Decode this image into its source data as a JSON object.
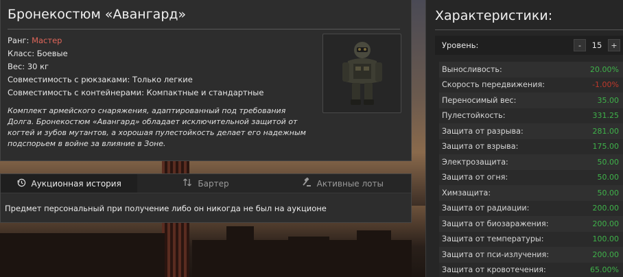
{
  "item": {
    "title": "Бронекостюм «Авангард»",
    "rank_label": "Ранг:",
    "rank_value": "Мастер",
    "class_line": "Класс: Боевые",
    "weight_line": "Вес: 30 кг",
    "backpack_line": "Совместимость с рюкзаками: Только легкие",
    "container_line": "Совместимость с контейнерами: Компактные и стандартные",
    "description": "Комплект армейского снаряжения, адаптированный под требования Долга. Бронекостюм «Авангард» обладает исключительной защитой от когтей и зубов мутантов, а хорошая пулестойкость делает его надежным подспорьем в войне за влияние в Зоне."
  },
  "tabs": [
    {
      "label": "Аукционная история",
      "icon": "history-icon",
      "active": true
    },
    {
      "label": "Бартер",
      "icon": "swap-icon",
      "active": false
    },
    {
      "label": "Активные лоты",
      "icon": "gavel-icon",
      "active": false
    }
  ],
  "tab_message": "Предмет персональный при получение либо он никогда не был на аукционе",
  "stats": {
    "title": "Характеристики:",
    "level_label": "Уровень:",
    "level_value": "15",
    "minus_label": "-",
    "plus_label": "+",
    "rows": [
      {
        "name": "Выносливость:",
        "value": "20.00%",
        "color": "#3fb24a"
      },
      {
        "name": "Скорость передвижения:",
        "value": "-1.00%",
        "color": "#c0392b"
      },
      {
        "name": "Переносимый вес:",
        "value": "35.00",
        "color": "#3fb24a"
      },
      {
        "name": "Пулестойкость:",
        "value": "331.25",
        "color": "#3fb24a"
      },
      {
        "name": "Защита от разрыва:",
        "value": "281.00",
        "color": "#3fb24a"
      },
      {
        "name": "Защита от взрыва:",
        "value": "175.00",
        "color": "#3fb24a"
      },
      {
        "name": "Электрозащита:",
        "value": "50.00",
        "color": "#3fb24a"
      },
      {
        "name": "Защита от огня:",
        "value": "50.00",
        "color": "#3fb24a"
      },
      {
        "name": "Химзащита:",
        "value": "50.00",
        "color": "#3fb24a"
      },
      {
        "name": "Защита от радиации:",
        "value": "200.00",
        "color": "#3fb24a"
      },
      {
        "name": "Защита от биозаражения:",
        "value": "200.00",
        "color": "#3fb24a"
      },
      {
        "name": "Защита от температуры:",
        "value": "100.00",
        "color": "#3fb24a"
      },
      {
        "name": "Защита от пси-излучения:",
        "value": "200.00",
        "color": "#3fb24a"
      },
      {
        "name": "Защита от кровотечения:",
        "value": "65.00%",
        "color": "#3fb24a"
      }
    ]
  }
}
